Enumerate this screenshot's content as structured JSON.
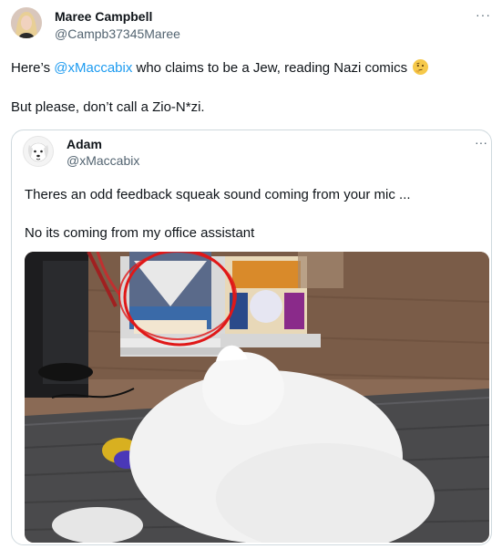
{
  "post": {
    "author_name": "Maree Campbell",
    "author_handle": "@Campb37345Maree",
    "more_label": "···",
    "line1_prefix": "Here’s ",
    "line1_mention": "@xMaccabix",
    "line1_suffix": " who claims to be a Jew, reading Nazi comics",
    "line2": "But please, don’t call a Zio-N*zi."
  },
  "quote": {
    "author_name": "Adam",
    "author_handle": "@xMaccabix",
    "more_label": "···",
    "line1": "Theres an odd feedback squeak sound coming from your mic ...",
    "line2": "No its coming from my office assistant"
  },
  "icons": {
    "emoji": "thinking-face-icon",
    "more": "more-icon"
  }
}
